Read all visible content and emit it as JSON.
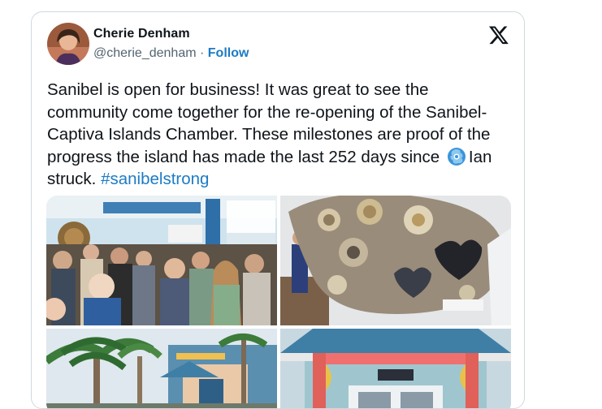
{
  "author": {
    "name": "Cherie Denham",
    "handle": "@cherie_denham",
    "separator": " · ",
    "follow_label": "Follow"
  },
  "tweet": {
    "text_before_icon": "Sanibel is open for business! It was great to see the community come together for the re-opening of the Sanibel-Captiva Islands Chamber. These milestones are proof of the progress the island has made the last 252 days since ",
    "text_after_icon": "Ian struck. ",
    "hashtag": "#sanibelstrong"
  },
  "icons": {
    "platform_logo": "x-logo-icon",
    "hurricane": "hurricane-emoji-icon",
    "avatar": "profile-photo"
  },
  "colors": {
    "link_blue": "#1d7bc4",
    "secondary_text": "#536471",
    "card_border": "#cfd9de"
  },
  "media": {
    "photos": [
      "chamber-crowd-photo",
      "shell-mosaic-sculpture-photo",
      "palm-trees-building-photo",
      "chamber-entrance-photo"
    ]
  }
}
